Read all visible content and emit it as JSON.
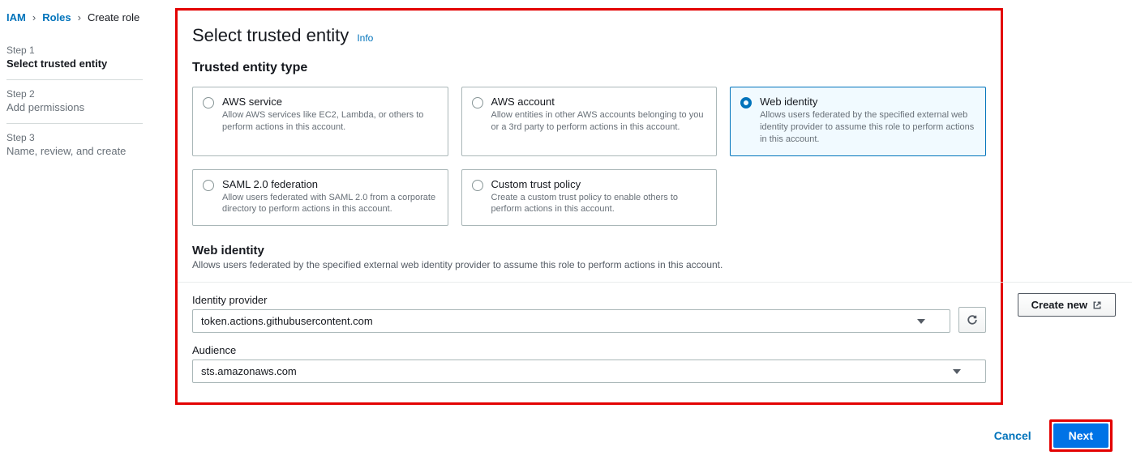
{
  "breadcrumb": {
    "iam": "IAM",
    "roles": "Roles",
    "current": "Create role"
  },
  "steps": [
    {
      "num": "Step 1",
      "label": "Select trusted entity",
      "active": true
    },
    {
      "num": "Step 2",
      "label": "Add permissions",
      "active": false
    },
    {
      "num": "Step 3",
      "label": "Name, review, and create",
      "active": false
    }
  ],
  "page_title": "Select trusted entity",
  "info_label": "Info",
  "entity_section_title": "Trusted entity type",
  "entities": [
    {
      "title": "AWS service",
      "desc": "Allow AWS services like EC2, Lambda, or others to perform actions in this account.",
      "selected": false
    },
    {
      "title": "AWS account",
      "desc": "Allow entities in other AWS accounts belonging to you or a 3rd party to perform actions in this account.",
      "selected": false
    },
    {
      "title": "Web identity",
      "desc": "Allows users federated by the specified external web identity provider to assume this role to perform actions in this account.",
      "selected": true
    },
    {
      "title": "SAML 2.0 federation",
      "desc": "Allow users federated with SAML 2.0 from a corporate directory to perform actions in this account.",
      "selected": false
    },
    {
      "title": "Custom trust policy",
      "desc": "Create a custom trust policy to enable others to perform actions in this account.",
      "selected": false
    }
  ],
  "web_identity": {
    "title": "Web identity",
    "desc": "Allows users federated by the specified external web identity provider to assume this role to perform actions in this account.",
    "idp_label": "Identity provider",
    "idp_value": "token.actions.githubusercontent.com",
    "audience_label": "Audience",
    "audience_value": "sts.amazonaws.com",
    "create_new": "Create new"
  },
  "footer": {
    "cancel": "Cancel",
    "next": "Next"
  }
}
